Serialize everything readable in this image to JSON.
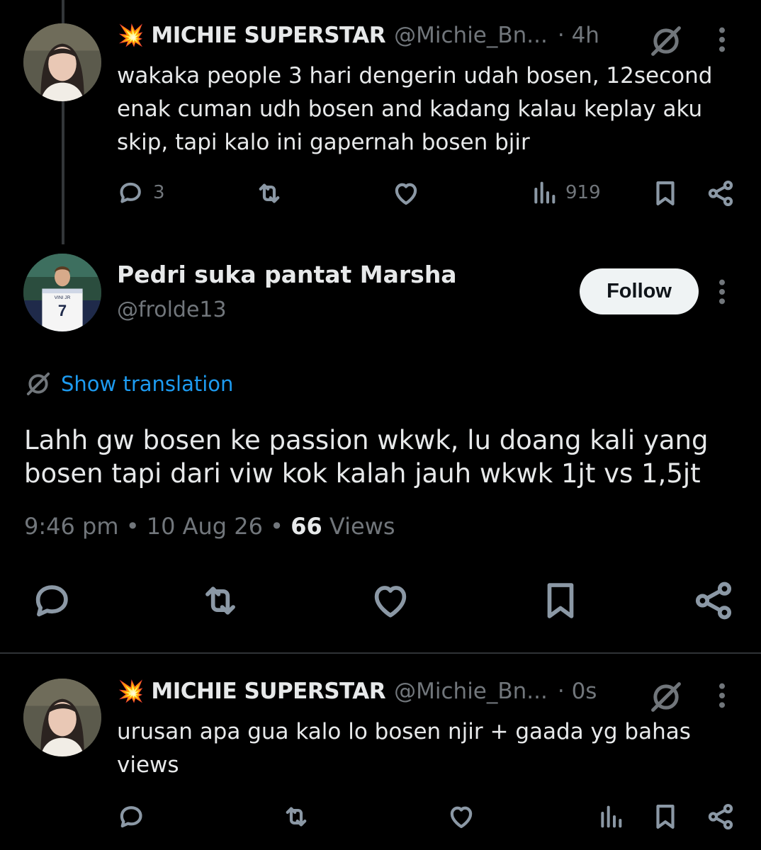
{
  "reply1": {
    "emoji": "💥",
    "name": "MICHIE SUPERSTAR",
    "handle": "@Michie_Bn...",
    "time": "· 4h",
    "text": "wakaka people 3 hari dengerin udah bosen, 12second enak cuman udh bosen and kadang kalau keplay aku skip, tapi kalo ini gapernah bosen bjir",
    "reply_count": "3",
    "views": "919"
  },
  "main_tweet": {
    "name": "Pedri suka pantat Marsha",
    "handle": "@frolde13",
    "follow_label": "Follow",
    "translation_label": "Show translation",
    "text": "Lahh gw bosen ke passion wkwk, lu doang kali yang bosen tapi dari viw kok kalah jauh wkwk 1jt vs 1,5jt",
    "time": "9:46 pm",
    "date": "10 Aug 26",
    "views_count": "66",
    "views_label": "Views",
    "jersey_text": "VINI JR",
    "jersey_number": "7"
  },
  "reply2": {
    "emoji": "💥",
    "name": "MICHIE SUPERSTAR",
    "handle": "@Michie_Bn...",
    "time": "· 0s",
    "text": "urusan apa gua kalo lo bosen njir + gaada yg bahas views"
  },
  "icons": {
    "reply": "comment-icon",
    "retweet": "repost-icon",
    "like": "heart-icon",
    "views": "analytics-icon",
    "bookmark": "bookmark-icon",
    "share": "share-icon",
    "grok": "grok-icon",
    "more": "more-vertical-icon"
  },
  "colors": {
    "background": "#000000",
    "text": "#e7e9ea",
    "secondary": "#71767b",
    "link": "#1d9bf0",
    "divider": "#2f3336"
  }
}
